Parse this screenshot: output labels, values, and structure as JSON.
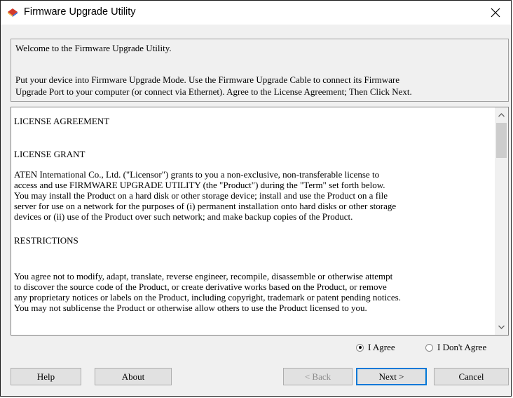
{
  "window": {
    "title": "Firmware Upgrade Utility"
  },
  "info": {
    "welcome": "Welcome to the Firmware Upgrade Utility.",
    "line1": "Put your device into Firmware Upgrade Mode. Use the Firmware Upgrade Cable to connect its Firmware",
    "line2": "Upgrade Port to your computer (or connect via Ethernet). Agree to the License Agreement; Then Click Next."
  },
  "license": {
    "heading": "LICENSE AGREEMENT",
    "grant_heading": "LICENSE GRANT",
    "grant_lines": [
      "ATEN International Co., Ltd. (\"Licensor\") grants to you a non-exclusive, non-transferable license to",
      "access and use FIRMWARE UPGRADE UTILITY (the \"Product\") during the \"Term\" set forth below.",
      "You may install the Product on a hard disk or other storage device; install and use the Product on a file",
      "server for use on a network for the purposes of (i) permanent installation onto hard disks or other storage",
      "devices or (ii) use of the Product over such network; and make backup copies of the Product."
    ],
    "restrictions_heading": "RESTRICTIONS",
    "restriction_lines": [
      "You agree not to modify, adapt, translate, reverse engineer, recompile, disassemble or otherwise attempt",
      "to discover the source code of the Product, or create derivative works based on the Product, or remove",
      "any proprietary notices or labels on the Product, including copyright, trademark or patent pending notices.",
      "You may not sublicense the Product or otherwise allow others to use the Product licensed to you."
    ]
  },
  "agreement": {
    "agree_label": "I Agree",
    "disagree_label": "I Don't Agree",
    "selected": "agree"
  },
  "buttons": {
    "help": "Help",
    "about": "About",
    "back": "< Back",
    "next": "Next >",
    "cancel": "Cancel"
  },
  "colors": {
    "focus": "#0078d7",
    "window_bg": "#f0f0f0",
    "thumb": "#cdcdcd"
  }
}
